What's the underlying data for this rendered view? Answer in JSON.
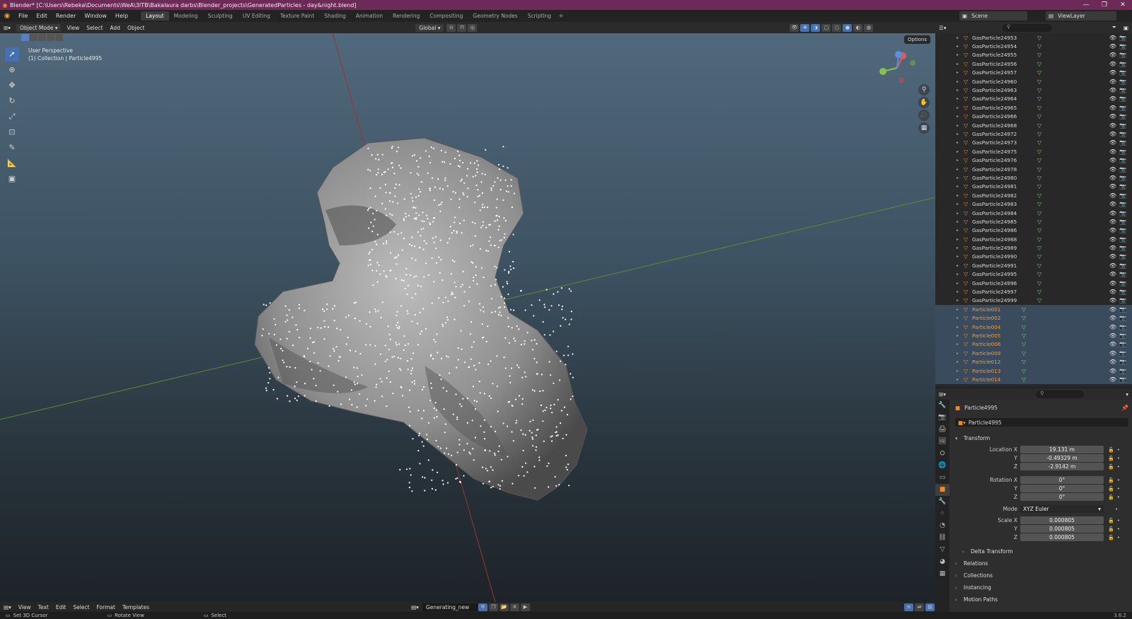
{
  "window": {
    "title": "Blender* [C:\\Users\\Rebeka\\Documents\\WeA\\3ITB\\Bakalaura darbs\\Blender_projects\\GeneratedParticles - day&night.blend]"
  },
  "menu": [
    "File",
    "Edit",
    "Render",
    "Window",
    "Help"
  ],
  "workspaces": [
    "Layout",
    "Modeling",
    "Sculpting",
    "UV Editing",
    "Texture Paint",
    "Shading",
    "Animation",
    "Rendering",
    "Compositing",
    "Geometry Nodes",
    "Scripting"
  ],
  "active_workspace": "Layout",
  "scene": {
    "name": "Scene",
    "view_layer": "ViewLayer"
  },
  "viewport_header": {
    "mode": "Object Mode",
    "menus": [
      "View",
      "Select",
      "Add",
      "Object"
    ],
    "orientation": "Global",
    "options": "Options"
  },
  "viewport": {
    "perspective": "User Perspective",
    "collection": "(1) Collection | Particle4995"
  },
  "outliner": {
    "items": [
      "GasParticle24953",
      "GasParticle24954",
      "GasParticle24955",
      "GasParticle24956",
      "GasParticle24957",
      "GasParticle24960",
      "GasParticle24963",
      "GasParticle24964",
      "GasParticle24965",
      "GasParticle24966",
      "GasParticle24968",
      "GasParticle24972",
      "GasParticle24973",
      "GasParticle24975",
      "GasParticle24976",
      "GasParticle24978",
      "GasParticle24980",
      "GasParticle24981",
      "GasParticle24982",
      "GasParticle24983",
      "GasParticle24984",
      "GasParticle24985",
      "GasParticle24986",
      "GasParticle24988",
      "GasParticle24989",
      "GasParticle24990",
      "GasParticle24991",
      "GasParticle24995",
      "GasParticle24996",
      "GasParticle24997",
      "GasParticle24999"
    ],
    "selected_items": [
      "Particle001",
      "Particle002",
      "Particle004",
      "Particle005",
      "Particle006",
      "Particle009",
      "Particle012",
      "Particle013",
      "Particle014"
    ]
  },
  "properties": {
    "object_name": "Particle4995",
    "data_name": "Particle4995",
    "transform_label": "Transform",
    "location": {
      "label": "Location X",
      "x": "19.131 m",
      "y": "-0.49329 m",
      "z": "-2.9142 m"
    },
    "rotation": {
      "label": "Rotation X",
      "x": "0°",
      "y": "0°",
      "z": "0°"
    },
    "mode": {
      "label": "Mode",
      "value": "XYZ Euler"
    },
    "scale": {
      "label": "Scale X",
      "x": "0.000805",
      "y": "0.000805",
      "z": "0.000805"
    },
    "axis_y": "Y",
    "axis_z": "Z",
    "panels": [
      "Delta Transform",
      "Relations",
      "Collections",
      "Instancing",
      "Motion Paths"
    ]
  },
  "text_editor": {
    "menus": [
      "View",
      "Text",
      "Edit",
      "Select",
      "Format",
      "Templates"
    ],
    "file": "Generating_new"
  },
  "statusbar": {
    "items": [
      "Set 3D Cursor",
      "Rotate View",
      "Select"
    ],
    "version": "3.6.2"
  },
  "colors": {
    "title_bg": "#6e2a56",
    "accent": "#4671b0",
    "selected_text": "#f29b3a"
  }
}
